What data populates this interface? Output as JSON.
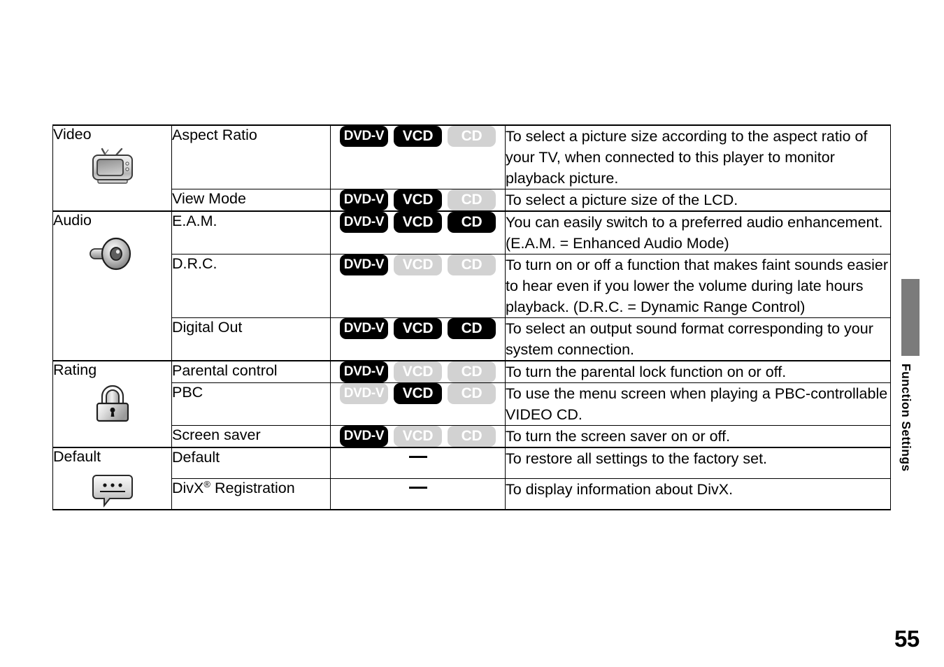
{
  "page": {
    "number": "55",
    "side_tab_label": "Function Settings",
    "dash_symbol": "—"
  },
  "badges": {
    "dvd_label": "DVD-V",
    "vcd_label": "VCD",
    "cd_label": "CD"
  },
  "table": {
    "sections": [
      {
        "category": "Video",
        "icon": "tv-icon",
        "rows": [
          {
            "item": "Aspect Ratio",
            "discs": {
              "dvd": true,
              "vcd": true,
              "cd": false
            },
            "description": "To select a picture size according to the aspect ratio of your TV, when connected to this player to monitor playback picture."
          },
          {
            "item": "View Mode",
            "discs": {
              "dvd": true,
              "vcd": true,
              "cd": false
            },
            "description": "To select a picture size of the LCD."
          }
        ]
      },
      {
        "category": "Audio",
        "icon": "speaker-icon",
        "rows": [
          {
            "item": "E.A.M.",
            "discs": {
              "dvd": true,
              "vcd": true,
              "cd": true
            },
            "description": "You can easily switch to a preferred audio enhancement. (E.A.M. = Enhanced Audio Mode)"
          },
          {
            "item": "D.R.C.",
            "discs": {
              "dvd": true,
              "vcd": false,
              "cd": false
            },
            "description": "To turn on or off a function that makes faint sounds easier to hear even if you lower the volume during late hours playback. (D.R.C. = Dynamic Range Control)"
          },
          {
            "item": "Digital Out",
            "discs": {
              "dvd": true,
              "vcd": true,
              "cd": true
            },
            "description": "To select an output sound format corresponding to your system connection."
          }
        ]
      },
      {
        "category": "Rating",
        "icon": "lock-icon",
        "rows": [
          {
            "item": "Parental control",
            "discs": {
              "dvd": true,
              "vcd": false,
              "cd": false
            },
            "description": "To turn the parental lock function on or off."
          },
          {
            "item": "PBC",
            "discs": {
              "dvd": false,
              "vcd": true,
              "cd": false
            },
            "description": "To use the menu screen when playing a PBC-controllable VIDEO CD."
          },
          {
            "item": "Screen saver",
            "discs": {
              "dvd": true,
              "vcd": false,
              "cd": false
            },
            "description": "To turn the screen saver on or off."
          }
        ]
      },
      {
        "category": "Default",
        "icon": "speech-bubble-icon",
        "rows": [
          {
            "item": "Default",
            "item_sup": "",
            "discs": null,
            "description": "To restore all settings to the factory set."
          },
          {
            "item": "DivX",
            "item_sup": "®",
            "item_tail": " Registration",
            "discs": null,
            "description": "To display information about DivX."
          }
        ]
      }
    ]
  }
}
